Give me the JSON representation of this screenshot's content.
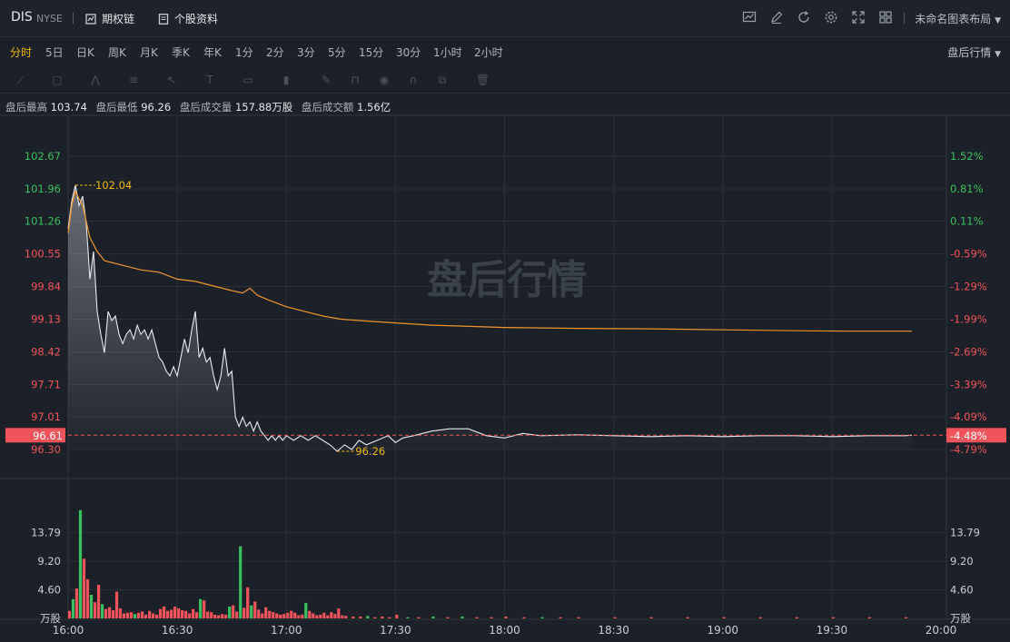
{
  "header": {
    "ticker": "DIS",
    "exchange": "NYSE",
    "options_link": "期权链",
    "profile_link": "个股资料",
    "layout_label": "未命名图表布局",
    "icons": [
      "indicator-icon",
      "draw-icon",
      "refresh-icon",
      "settings-icon",
      "fullscreen-icon",
      "grid-icon"
    ]
  },
  "periods": [
    "分时",
    "5日",
    "日K",
    "周K",
    "月K",
    "季K",
    "年K",
    "1分",
    "2分",
    "3分",
    "5分",
    "15分",
    "30分",
    "1小时",
    "2小时"
  ],
  "active_period": "分时",
  "session_select": "盘后行情",
  "stats": {
    "high_label": "盘后最高",
    "high": "103.74",
    "low_label": "盘后最低",
    "low": "96.26",
    "vol_label": "盘后成交量",
    "vol": "157.88万股",
    "amt_label": "盘后成交额",
    "amt": "1.56亿"
  },
  "watermark": "盘后行情",
  "chart_data": {
    "type": "line",
    "session": "after-hours",
    "price_axis": [
      "102.67",
      "101.96",
      "101.26",
      "100.55",
      "99.84",
      "99.13",
      "98.42",
      "97.71",
      "97.01",
      "96.30"
    ],
    "pct_axis": [
      "1.52%",
      "0.81%",
      "0.11%",
      "-0.59%",
      "-1.29%",
      "-1.99%",
      "-2.69%",
      "-3.39%",
      "-4.09%",
      "-4.79%"
    ],
    "y_range": [
      96.3,
      102.67
    ],
    "ref_price": 101.13,
    "current_price": "96.61",
    "current_pct": "-4.48%",
    "max_marker": "102.04",
    "min_marker": "96.26",
    "x_ticks": [
      "16:00",
      "16:30",
      "17:00",
      "17:30",
      "18:00",
      "18:30",
      "19:00",
      "19:30",
      "20:00"
    ],
    "x_range_minutes": [
      0,
      240
    ],
    "price_series": [
      [
        0,
        101.1
      ],
      [
        1,
        101.7
      ],
      [
        2,
        102.04
      ],
      [
        3,
        101.6
      ],
      [
        4,
        101.8
      ],
      [
        5,
        101.2
      ],
      [
        6,
        100.0
      ],
      [
        7,
        100.6
      ],
      [
        8,
        99.3
      ],
      [
        9,
        98.8
      ],
      [
        10,
        98.4
      ],
      [
        11,
        99.3
      ],
      [
        12,
        99.1
      ],
      [
        13,
        99.2
      ],
      [
        14,
        98.8
      ],
      [
        15,
        98.6
      ],
      [
        16,
        98.8
      ],
      [
        17,
        98.9
      ],
      [
        18,
        98.7
      ],
      [
        19,
        99.0
      ],
      [
        20,
        98.8
      ],
      [
        21,
        98.9
      ],
      [
        22,
        98.7
      ],
      [
        23,
        98.9
      ],
      [
        24,
        98.6
      ],
      [
        25,
        98.3
      ],
      [
        26,
        98.2
      ],
      [
        27,
        98.0
      ],
      [
        28,
        97.9
      ],
      [
        29,
        98.1
      ],
      [
        30,
        97.9
      ],
      [
        31,
        98.3
      ],
      [
        32,
        98.7
      ],
      [
        33,
        98.4
      ],
      [
        34,
        98.9
      ],
      [
        35,
        99.3
      ],
      [
        36,
        98.3
      ],
      [
        37,
        98.5
      ],
      [
        38,
        98.2
      ],
      [
        39,
        98.3
      ],
      [
        40,
        97.9
      ],
      [
        41,
        97.6
      ],
      [
        42,
        97.9
      ],
      [
        43,
        98.5
      ],
      [
        44,
        97.9
      ],
      [
        45,
        98.0
      ],
      [
        46,
        97.0
      ],
      [
        47,
        96.8
      ],
      [
        48,
        97.0
      ],
      [
        49,
        96.8
      ],
      [
        50,
        96.9
      ],
      [
        51,
        96.7
      ],
      [
        52,
        96.9
      ],
      [
        53,
        96.7
      ],
      [
        54,
        96.6
      ],
      [
        55,
        96.5
      ],
      [
        56,
        96.6
      ],
      [
        57,
        96.5
      ],
      [
        58,
        96.6
      ],
      [
        59,
        96.5
      ],
      [
        60,
        96.6
      ],
      [
        62,
        96.5
      ],
      [
        64,
        96.6
      ],
      [
        66,
        96.5
      ],
      [
        68,
        96.6
      ],
      [
        70,
        96.5
      ],
      [
        72,
        96.4
      ],
      [
        74,
        96.26
      ],
      [
        76,
        96.4
      ],
      [
        78,
        96.3
      ],
      [
        80,
        96.5
      ],
      [
        82,
        96.4
      ],
      [
        85,
        96.5
      ],
      [
        88,
        96.6
      ],
      [
        90,
        96.45
      ],
      [
        92,
        96.55
      ],
      [
        95,
        96.6
      ],
      [
        100,
        96.7
      ],
      [
        105,
        96.75
      ],
      [
        110,
        96.75
      ],
      [
        115,
        96.6
      ],
      [
        120,
        96.55
      ],
      [
        125,
        96.65
      ],
      [
        130,
        96.6
      ],
      [
        140,
        96.62
      ],
      [
        150,
        96.6
      ],
      [
        160,
        96.58
      ],
      [
        170,
        96.6
      ],
      [
        180,
        96.58
      ],
      [
        190,
        96.6
      ],
      [
        200,
        96.6
      ],
      [
        210,
        96.58
      ],
      [
        220,
        96.6
      ],
      [
        230,
        96.6
      ],
      [
        232,
        96.61
      ]
    ],
    "avg_series": [
      [
        0,
        101.0
      ],
      [
        1,
        101.6
      ],
      [
        2,
        101.9
      ],
      [
        4,
        101.6
      ],
      [
        6,
        100.9
      ],
      [
        8,
        100.6
      ],
      [
        10,
        100.4
      ],
      [
        15,
        100.3
      ],
      [
        20,
        100.2
      ],
      [
        25,
        100.15
      ],
      [
        30,
        100.0
      ],
      [
        35,
        99.95
      ],
      [
        40,
        99.85
      ],
      [
        45,
        99.75
      ],
      [
        48,
        99.7
      ],
      [
        50,
        99.8
      ],
      [
        52,
        99.65
      ],
      [
        55,
        99.55
      ],
      [
        60,
        99.4
      ],
      [
        65,
        99.3
      ],
      [
        70,
        99.2
      ],
      [
        75,
        99.13
      ],
      [
        80,
        99.1
      ],
      [
        90,
        99.05
      ],
      [
        100,
        99.0
      ],
      [
        120,
        98.95
      ],
      [
        140,
        98.93
      ],
      [
        160,
        98.92
      ],
      [
        180,
        98.9
      ],
      [
        200,
        98.88
      ],
      [
        215,
        98.87
      ],
      [
        232,
        98.87
      ]
    ],
    "volume_axis": [
      "13.79",
      "9.20",
      "4.60",
      "万股"
    ],
    "volume_range": [
      0,
      18.4
    ],
    "volume": [
      [
        0,
        1.2,
        0
      ],
      [
        1,
        3.1,
        1
      ],
      [
        2,
        4.8,
        0
      ],
      [
        3,
        17.4,
        1
      ],
      [
        4,
        9.6,
        0
      ],
      [
        5,
        6.3,
        0
      ],
      [
        6,
        3.8,
        1
      ],
      [
        7,
        2.6,
        0
      ],
      [
        8,
        5.4,
        0
      ],
      [
        9,
        2.3,
        1
      ],
      [
        10,
        1.5,
        0
      ],
      [
        11,
        1.8,
        0
      ],
      [
        12,
        1.3,
        0
      ],
      [
        13,
        4.3,
        0
      ],
      [
        14,
        1.6,
        0
      ],
      [
        15,
        0.8,
        0
      ],
      [
        16,
        0.9,
        0
      ],
      [
        17,
        1.0,
        0
      ],
      [
        18,
        0.7,
        1
      ],
      [
        19,
        0.9,
        0
      ],
      [
        20,
        1.1,
        0
      ],
      [
        21,
        0.6,
        0
      ],
      [
        22,
        1.2,
        0
      ],
      [
        23,
        0.8,
        0
      ],
      [
        24,
        0.6,
        0
      ],
      [
        25,
        1.5,
        0
      ],
      [
        26,
        1.9,
        0
      ],
      [
        27,
        1.2,
        0
      ],
      [
        28,
        1.4,
        0
      ],
      [
        29,
        1.9,
        0
      ],
      [
        30,
        1.6,
        0
      ],
      [
        31,
        1.3,
        0
      ],
      [
        32,
        1.2,
        0
      ],
      [
        33,
        0.8,
        0
      ],
      [
        34,
        1.5,
        0
      ],
      [
        35,
        1.0,
        0
      ],
      [
        36,
        3.1,
        1
      ],
      [
        37,
        2.9,
        0
      ],
      [
        38,
        1.1,
        0
      ],
      [
        39,
        1.0,
        0
      ],
      [
        40,
        0.6,
        0
      ],
      [
        41,
        0.5,
        0
      ],
      [
        42,
        0.7,
        0
      ],
      [
        43,
        0.6,
        0
      ],
      [
        44,
        1.9,
        1
      ],
      [
        45,
        2.1,
        0
      ],
      [
        46,
        1.1,
        0
      ],
      [
        47,
        11.6,
        1
      ],
      [
        48,
        1.7,
        0
      ],
      [
        49,
        5.0,
        0
      ],
      [
        50,
        2.1,
        1
      ],
      [
        51,
        2.7,
        0
      ],
      [
        52,
        1.4,
        0
      ],
      [
        53,
        0.8,
        0
      ],
      [
        54,
        1.8,
        0
      ],
      [
        55,
        1.2,
        0
      ],
      [
        56,
        1.0,
        0
      ],
      [
        57,
        0.8,
        0
      ],
      [
        58,
        0.6,
        0
      ],
      [
        59,
        0.7,
        0
      ],
      [
        60,
        0.9,
        0
      ],
      [
        61,
        1.2,
        0
      ],
      [
        62,
        0.9,
        0
      ],
      [
        63,
        0.5,
        0
      ],
      [
        64,
        0.6,
        0
      ],
      [
        65,
        2.5,
        1
      ],
      [
        66,
        1.2,
        0
      ],
      [
        67,
        0.8,
        0
      ],
      [
        68,
        0.5,
        0
      ],
      [
        69,
        0.6,
        0
      ],
      [
        70,
        0.9,
        0
      ],
      [
        71,
        0.5,
        0
      ],
      [
        72,
        1.0,
        0
      ],
      [
        73,
        0.7,
        0
      ],
      [
        74,
        1.6,
        0
      ],
      [
        75,
        0.5,
        0
      ],
      [
        76,
        0.4,
        0
      ],
      [
        78,
        0.3,
        0
      ],
      [
        80,
        0.3,
        0
      ],
      [
        82,
        0.4,
        1
      ],
      [
        84,
        0.2,
        0
      ],
      [
        86,
        0.3,
        0
      ],
      [
        88,
        0.2,
        0
      ],
      [
        90,
        0.6,
        0
      ],
      [
        93,
        0.2,
        1
      ],
      [
        96,
        0.2,
        0
      ],
      [
        100,
        0.3,
        1
      ],
      [
        104,
        0.2,
        0
      ],
      [
        108,
        0.3,
        1
      ],
      [
        112,
        0.2,
        0
      ],
      [
        116,
        0.2,
        0
      ],
      [
        120,
        0.3,
        0
      ],
      [
        125,
        0.2,
        0
      ],
      [
        130,
        0.2,
        1
      ],
      [
        135,
        0.2,
        0
      ],
      [
        140,
        0.2,
        0
      ],
      [
        150,
        0.2,
        0
      ],
      [
        160,
        0.2,
        0
      ],
      [
        170,
        0.2,
        0
      ],
      [
        180,
        0.2,
        0
      ],
      [
        190,
        0.2,
        0
      ],
      [
        200,
        0.2,
        0
      ],
      [
        210,
        0.2,
        0
      ],
      [
        220,
        0.2,
        0
      ],
      [
        230,
        0.2,
        0
      ]
    ],
    "colors": {
      "price": "#e8eaed",
      "avg": "#f0952e",
      "up": "#f05359",
      "down": "#39c05f",
      "marker": "#f0b90b",
      "ref": "#f05359"
    }
  }
}
